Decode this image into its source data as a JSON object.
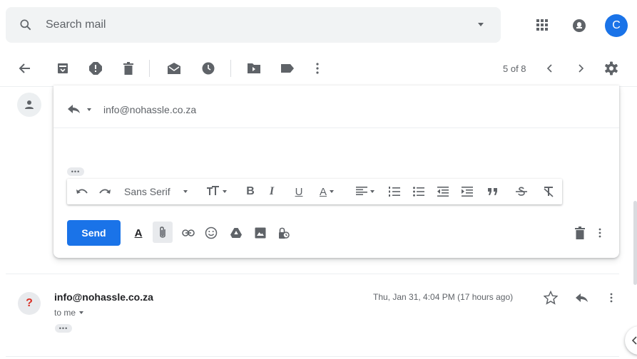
{
  "search": {
    "placeholder": "Search mail"
  },
  "account": {
    "avatar_letter": "C"
  },
  "toolbar": {
    "pager": "5 of 8"
  },
  "reply": {
    "to": "info@nohassle.co.za",
    "collapsed_dots": "•••",
    "send_label": "Send",
    "formatting": {
      "font_name": "Sans Serif",
      "bold": "B",
      "italic": "I",
      "underline": "U",
      "text_color": "A"
    },
    "formatting_text_icon": "A"
  },
  "message": {
    "from": "info@nohassle.co.za",
    "avatar": "?",
    "to": "to me",
    "date": "Thu, Jan 31, 4:04 PM (17 hours ago)",
    "collapsed_dots": "•••"
  },
  "colors": {
    "accent": "#1a73e8",
    "icon": "#5f6368",
    "sender_mark": "#d93025"
  },
  "icons": [
    "search-icon",
    "apps-icon",
    "notifications-icon",
    "back-icon",
    "archive-icon",
    "report-spam-icon",
    "delete-icon",
    "mark-unread-icon",
    "snooze-icon",
    "move-to-icon",
    "label-icon",
    "more-icon",
    "prev-icon",
    "next-icon",
    "settings-icon",
    "reply-icon",
    "undo-icon",
    "redo-icon",
    "text-size-icon",
    "align-icon",
    "numbered-list-icon",
    "bulleted-list-icon",
    "indent-less-icon",
    "indent-more-icon",
    "quote-icon",
    "strikethrough-icon",
    "remove-formatting-icon",
    "attach-icon",
    "link-icon",
    "emoji-icon",
    "drive-icon",
    "photo-icon",
    "confidential-icon",
    "discard-icon",
    "star-icon"
  ]
}
